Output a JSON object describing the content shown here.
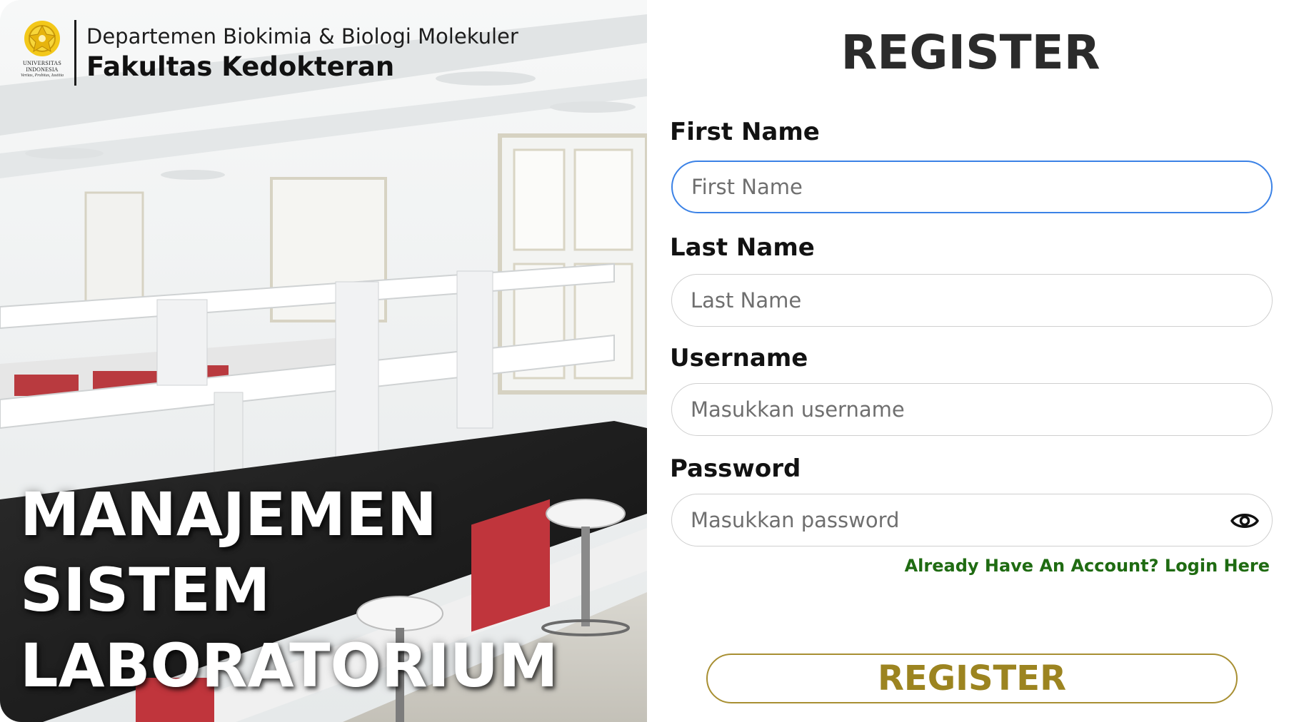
{
  "brand": {
    "logo_lines": [
      "UNIVERSITAS",
      "INDONESIA"
    ],
    "logo_motto": "Veritas, Probitas, Iustitia",
    "department": "Departemen Biokimia & Biologi Molekuler",
    "faculty": "Fakultas Kedokteran"
  },
  "hero": {
    "title_lines": [
      "MANAJEMEN",
      "SISTEM",
      "LABORATORIUM"
    ]
  },
  "form": {
    "title": "REGISTER",
    "fields": {
      "first_name": {
        "label": "First Name",
        "placeholder": "First Name",
        "value": ""
      },
      "last_name": {
        "label": "Last Name",
        "placeholder": "Last Name",
        "value": ""
      },
      "username": {
        "label": "Username",
        "placeholder": "Masukkan username",
        "value": ""
      },
      "password": {
        "label": "Password",
        "placeholder": "Masukkan password",
        "value": ""
      }
    },
    "login_link": "Already Have An Account? Login Here",
    "submit_label": "REGISTER"
  },
  "colors": {
    "focus_border": "#3b82e6",
    "link_green": "#1f6b12",
    "gold": "#9c8420",
    "title_dark": "#2b2b2b"
  },
  "icons": {
    "password_toggle": "eye-icon",
    "logo": "makara-emblem-icon"
  }
}
